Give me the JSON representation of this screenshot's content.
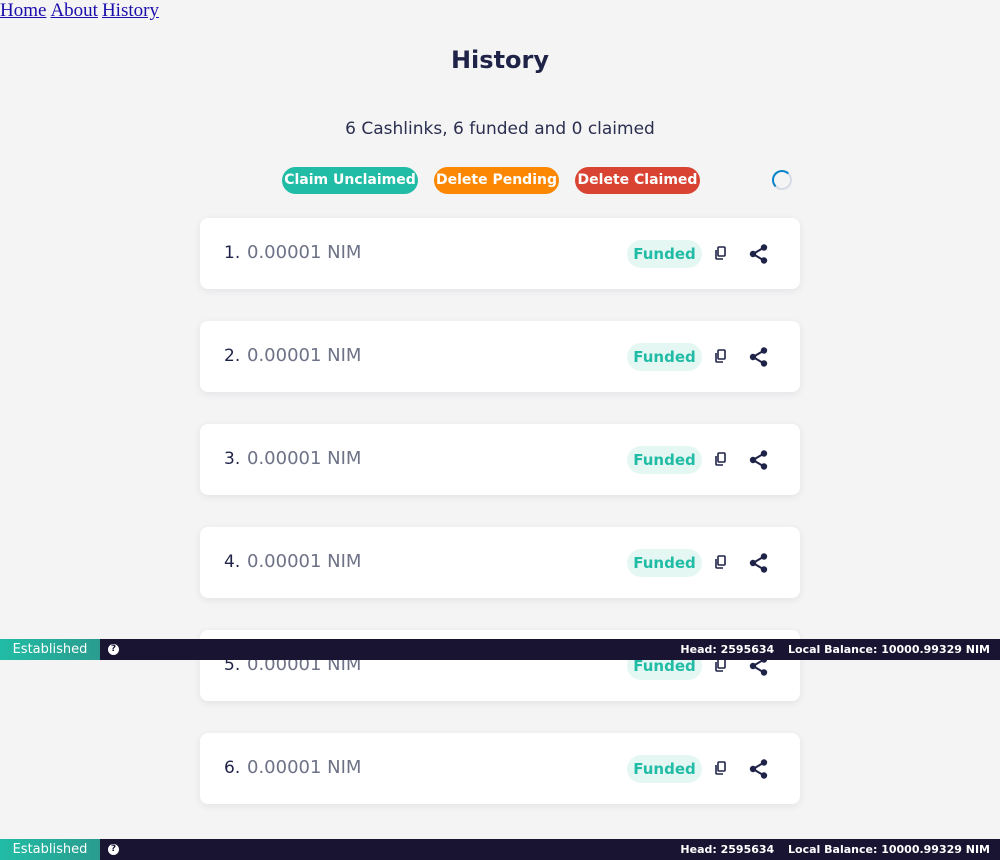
{
  "nav": {
    "home": "Home",
    "about": "About",
    "history": "History"
  },
  "page": {
    "title": "History",
    "summary": "6 Cashlinks, 6 funded and 0 claimed"
  },
  "actions": {
    "claim_unclaimed": "Claim Unclaimed",
    "delete_pending": "Delete Pending",
    "delete_claimed": "Delete Claimed"
  },
  "cashlinks": [
    {
      "index": "1.",
      "amount": "0.00001 NIM",
      "status": "Funded"
    },
    {
      "index": "2.",
      "amount": "0.00001 NIM",
      "status": "Funded"
    },
    {
      "index": "3.",
      "amount": "0.00001 NIM",
      "status": "Funded"
    },
    {
      "index": "4.",
      "amount": "0.00001 NIM",
      "status": "Funded"
    },
    {
      "index": "5.",
      "amount": "0.00001 NIM",
      "status": "Funded"
    },
    {
      "index": "6.",
      "amount": "0.00001 NIM",
      "status": "Funded"
    }
  ],
  "statusbar": {
    "state": "Established",
    "head": "Head: 2595634",
    "balance": "Local Balance: 10000.99329 NIM"
  },
  "colors": {
    "accent": "#21bca5",
    "orange": "#fc8702",
    "red": "#d94432",
    "dark": "#1f2348"
  },
  "icons": {
    "copy": "copy-icon",
    "share": "share-icon",
    "help": "help-icon",
    "spinner": "loading-spinner"
  }
}
